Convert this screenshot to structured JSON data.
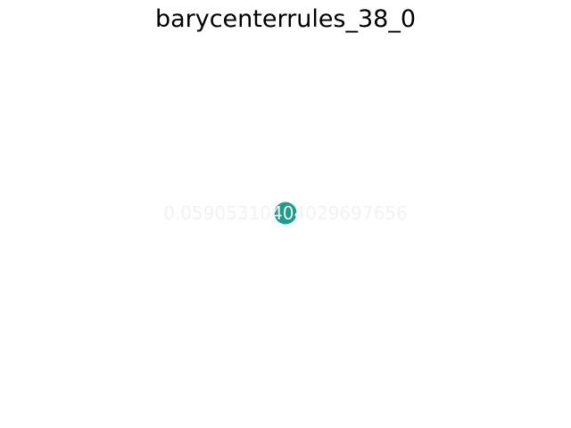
{
  "title": "barycenterrules_38_0",
  "graph": {
    "nodes": [
      {
        "id": "node-0",
        "label": "0.05905310404029697656",
        "color": "#1f9b8a"
      }
    ],
    "edges": [],
    "label_color": "#f2f2f2"
  }
}
